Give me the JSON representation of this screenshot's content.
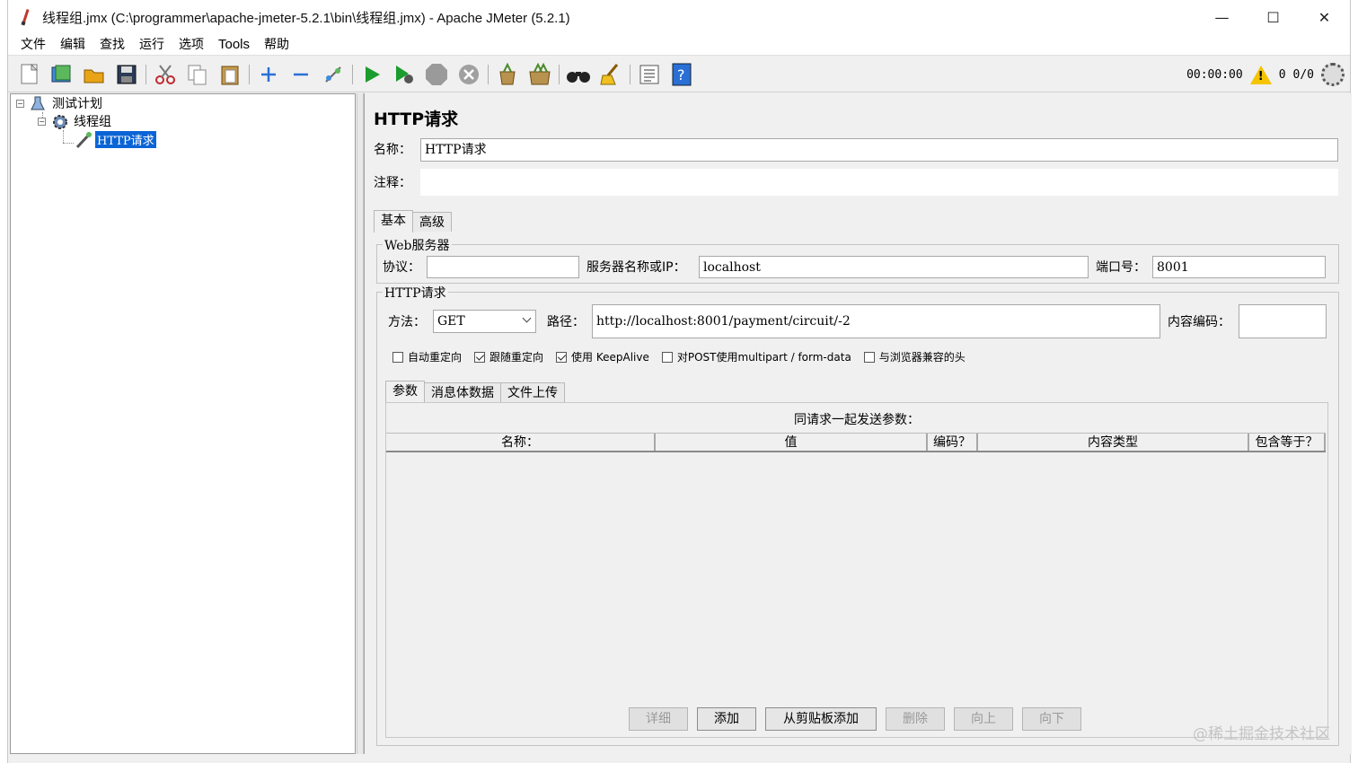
{
  "window": {
    "title": "线程组.jmx (C:\\programmer\\apache-jmeter-5.2.1\\bin\\线程组.jmx) - Apache JMeter (5.2.1)",
    "controls": {
      "minimize": "—",
      "maximize": "☐",
      "close": "✕"
    }
  },
  "menu": [
    "文件",
    "编辑",
    "查找",
    "运行",
    "选项",
    "Tools",
    "帮助"
  ],
  "toolbar": {
    "icons": [
      "new-icon",
      "templates-icon",
      "open-icon",
      "save-icon",
      "cut-icon",
      "copy-icon",
      "paste-icon",
      "expand-icon",
      "collapse-icon",
      "toggle-icon",
      "start-icon",
      "start-no-pause-icon",
      "stop-icon",
      "shutdown-icon",
      "clear-icon",
      "clear-all-icon",
      "search-icon",
      "reset-search-icon",
      "function-helper-icon",
      "help-icon"
    ],
    "timer": "00:00:00",
    "warning_count": "0",
    "threads": "0/0"
  },
  "tree": {
    "nodes": [
      {
        "label": "测试计划",
        "icon": "test-plan-icon",
        "toggle": "⊟"
      },
      {
        "label": "线程组",
        "icon": "thread-group-icon",
        "toggle": "⊟"
      },
      {
        "label": "HTTP请求",
        "icon": "http-sampler-icon",
        "selected": true
      }
    ]
  },
  "panel": {
    "title": "HTTP请求",
    "name_label": "名称：",
    "name_value": "HTTP请求",
    "comment_label": "注释：",
    "comment_value": "",
    "tabs": [
      "基本",
      "高级"
    ],
    "web_server": {
      "title": "Web服务器",
      "protocol_label": "协议：",
      "protocol_value": "",
      "server_label": "服务器名称或IP：",
      "server_value": "localhost",
      "port_label": "端口号：",
      "port_value": "8001"
    },
    "http_request": {
      "title": "HTTP请求",
      "method_label": "方法：",
      "method_value": "GET",
      "path_label": "路径：",
      "path_value": "http://localhost:8001/payment/circuit/-2",
      "encoding_label": "内容编码：",
      "encoding_value": ""
    },
    "checkboxes": [
      {
        "label": "自动重定向",
        "checked": false
      },
      {
        "label": "跟随重定向",
        "checked": true
      },
      {
        "label": "使用 KeepAlive",
        "checked": true
      },
      {
        "label": "对POST使用multipart / form-data",
        "checked": false
      },
      {
        "label": "与浏览器兼容的头",
        "checked": false
      }
    ],
    "sub_tabs": [
      "参数",
      "消息体数据",
      "文件上传"
    ],
    "params_caption": "同请求一起发送参数：",
    "columns": [
      "名称：",
      "值",
      "编码？",
      "内容类型",
      "包含等于？"
    ],
    "buttons": [
      {
        "label": "详细",
        "enabled": false
      },
      {
        "label": "添加",
        "enabled": true
      },
      {
        "label": "从剪贴板添加",
        "enabled": true
      },
      {
        "label": "删除",
        "enabled": false
      },
      {
        "label": "向上",
        "enabled": false
      },
      {
        "label": "向下",
        "enabled": false
      }
    ]
  },
  "watermark": "@稀土掘金技术社区",
  "colors": {
    "selection": "#0a64d6",
    "run_green": "#1a9c2e",
    "warning": "#f5c400"
  }
}
